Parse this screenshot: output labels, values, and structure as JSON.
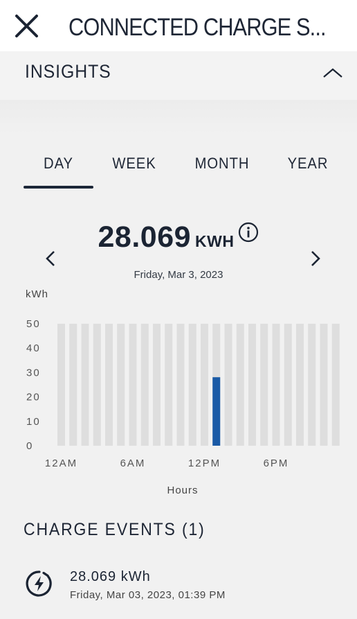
{
  "header": {
    "title": "CONNECTED CHARGE S...",
    "close_icon": "close-icon"
  },
  "insights": {
    "label": "INSIGHTS",
    "collapse_icon": "chevron-up-icon"
  },
  "tabs": [
    {
      "label": "DAY",
      "selected": true
    },
    {
      "label": "WEEK",
      "selected": false
    },
    {
      "label": "MONTH",
      "selected": false
    },
    {
      "label": "YEAR",
      "selected": false
    }
  ],
  "summary": {
    "value": "28.069",
    "unit": "KWH",
    "date": "Friday, Mar 3, 2023",
    "info_icon": "info-icon",
    "prev_icon": "chevron-left-icon",
    "next_icon": "chevron-right-icon"
  },
  "chart_data": {
    "type": "bar",
    "ylabel": "kWh",
    "xlabel": "Hours",
    "ylim": [
      0,
      50
    ],
    "yticks": [
      0,
      10,
      20,
      30,
      40,
      50
    ],
    "x_tick_labels": [
      {
        "hour": 0,
        "label": "12AM"
      },
      {
        "hour": 6,
        "label": "6AM"
      },
      {
        "hour": 12,
        "label": "12PM"
      },
      {
        "hour": 18,
        "label": "6PM"
      }
    ],
    "categories": [
      0,
      1,
      2,
      3,
      4,
      5,
      6,
      7,
      8,
      9,
      10,
      11,
      12,
      13,
      14,
      15,
      16,
      17,
      18,
      19,
      20,
      21,
      22,
      23
    ],
    "values": [
      0,
      0,
      0,
      0,
      0,
      0,
      0,
      0,
      0,
      0,
      0,
      0,
      0,
      28.069,
      0,
      0,
      0,
      0,
      0,
      0,
      0,
      0,
      0,
      0
    ],
    "grid": false,
    "colors": {
      "bar": "#1a5aa6",
      "background_bar": "#dedede"
    }
  },
  "events": {
    "title": "CHARGE EVENTS (1)",
    "items": [
      {
        "energy": "28.069 kWh",
        "timestamp": "Friday, Mar 03, 2023, 01:39 PM",
        "icon": "charging-bolt-icon"
      }
    ]
  }
}
